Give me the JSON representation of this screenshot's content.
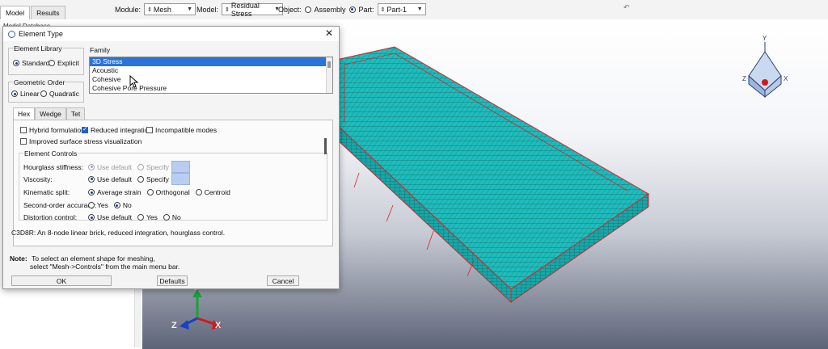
{
  "toolbar": {
    "tabs": [
      "Model",
      "Results"
    ],
    "module_label": "Module:",
    "module_value": "Mesh",
    "model_label": "Model:",
    "model_value": "Residual Stress",
    "object_label": "Object:",
    "object_assembly": "Assembly",
    "object_part": "Part:",
    "part_value": "Part-1"
  },
  "tree": {
    "root_label": "Model Database"
  },
  "dialog": {
    "title": "Element Type",
    "element_library": {
      "label": "Element Library",
      "options": [
        "Standard",
        "Explicit"
      ],
      "selected": "Standard"
    },
    "family": {
      "label": "Family",
      "items": [
        "3D Stress",
        "Acoustic",
        "Cohesive",
        "Cohesive Pore Pressure"
      ],
      "selected": "3D Stress"
    },
    "geometric_order": {
      "label": "Geometric Order",
      "options": [
        "Linear",
        "Quadratic"
      ],
      "selected": "Linear"
    },
    "shape_tabs": [
      "Hex",
      "Wedge",
      "Tet"
    ],
    "active_tab": "Hex",
    "checkboxes": {
      "hybrid": "Hybrid formulation",
      "reduced": "Reduced integration",
      "incompatible": "Incompatible modes",
      "improved": "Improved surface stress visualization"
    },
    "element_controls": {
      "label": "Element Controls",
      "hourglass": {
        "label": "Hourglass stiffness:",
        "opt1": "Use default",
        "opt2": "Specify"
      },
      "viscosity": {
        "label": "Viscosity:",
        "opt1": "Use default",
        "opt2": "Specify"
      },
      "kinematic": {
        "label": "Kinematic split:",
        "opt1": "Average strain",
        "opt2": "Orthogonal",
        "opt3": "Centroid"
      },
      "second_order": {
        "label": "Second-order accuracy:",
        "opt1": "Yes",
        "opt2": "No"
      },
      "distortion": {
        "label": "Distortion control:",
        "opt1": "Use default",
        "opt2": "Yes",
        "opt3": "No"
      }
    },
    "description": "C3D8R:  An 8-node linear brick, reduced integration, hourglass control.",
    "note_label": "Note:",
    "note_line1": "To select an element shape for meshing,",
    "note_line2": "select \"Mesh->Controls\" from the main menu bar.",
    "buttons": {
      "ok": "OK",
      "defaults": "Defaults",
      "cancel": "Cancel"
    }
  },
  "viewport": {
    "triad_labels": {
      "y": "Y",
      "z": "Z",
      "x": "X"
    },
    "mesh_color": "#1fbcbc",
    "edge_color": "#e0202a"
  }
}
